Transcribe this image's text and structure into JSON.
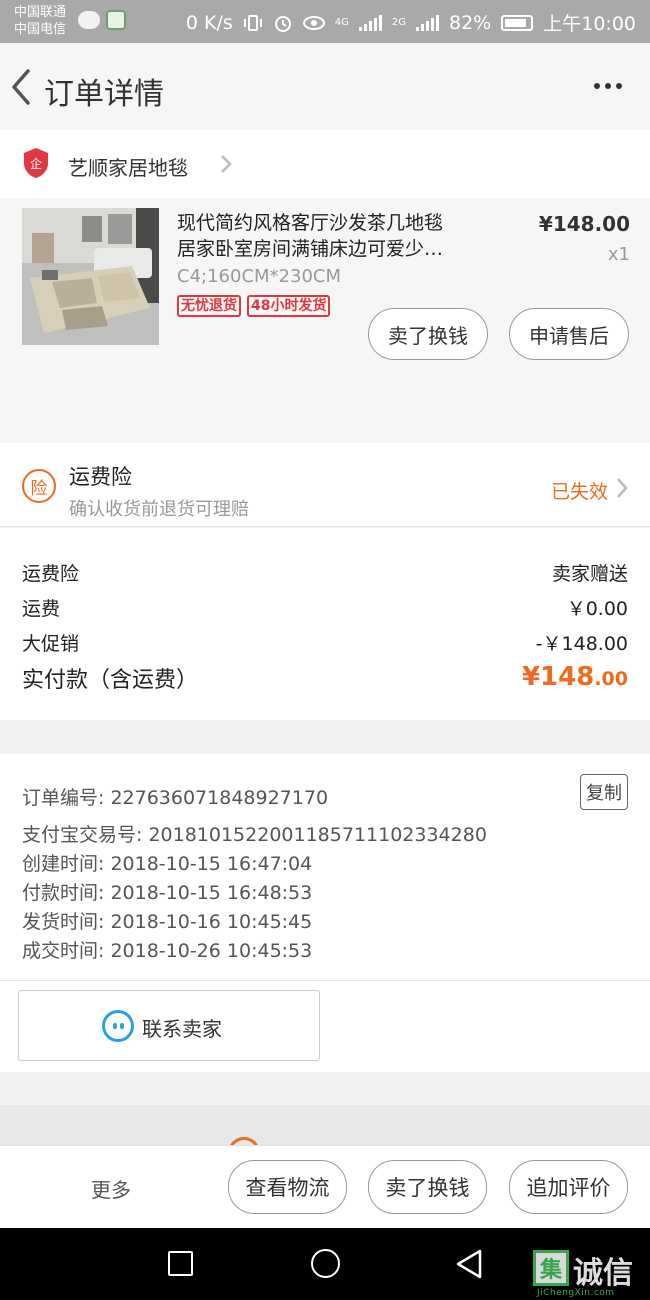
{
  "status_bar": {
    "carrier1": "中国联通",
    "carrier2": "中国电信",
    "speed": "0 K/s",
    "net_4g": "4G",
    "net_2g": "2G",
    "battery": "82%",
    "time": "上午10:00"
  },
  "header": {
    "title": "订单详情"
  },
  "shop": {
    "name": "艺顺家居地毯"
  },
  "product": {
    "title_line1": "现代简约风格客厅沙发茶几地毯",
    "title_line2": "居家卧室房间满铺床边可爱少…",
    "spec": "C4;160CM*230CM",
    "tag1": "无忧退货",
    "tag2": "48小时发货",
    "price": "¥148.00",
    "qty": "x1",
    "btn_sell": "卖了换钱",
    "btn_aftersale": "申请售后"
  },
  "insurance": {
    "icon_char": "险",
    "title": "运费险",
    "subtitle": "确认收货前退货可理赔",
    "status": "已失效"
  },
  "fees": {
    "row1_label": "运费险",
    "row1_value": "卖家赠送",
    "row2_label": "运费",
    "row2_value": "￥0.00",
    "row3_label": "大促销",
    "row3_value": "-￥148.00",
    "total_label": "实付款（含运费）",
    "total_currency": "¥",
    "total_int": "148",
    "total_dec": ".00"
  },
  "order_info": {
    "order_no": "订单编号: 227636071848927170",
    "copy_label": "复制",
    "alipay_no": "支付宝交易号: 2018101522001185711102334280",
    "created": "创建时间: 2018-10-15 16:47:04",
    "paid": "付款时间: 2018-10-15 16:48:53",
    "shipped": "发货时间: 2018-10-16 10:45:45",
    "completed": "成交时间: 2018-10-26 10:45:53",
    "contact_label": "联系卖家"
  },
  "bottom_bar": {
    "more": "更多",
    "btn_logistics": "查看物流",
    "btn_sell": "卖了换钱",
    "btn_review": "追加评价"
  },
  "watermark": {
    "box_char": "集",
    "text": "诚信",
    "sub": "JiChengXin.com"
  },
  "colors": {
    "accent_orange": "#f06a1d",
    "tag_red": "#e0383e",
    "contact_blue": "#29a0e6"
  }
}
